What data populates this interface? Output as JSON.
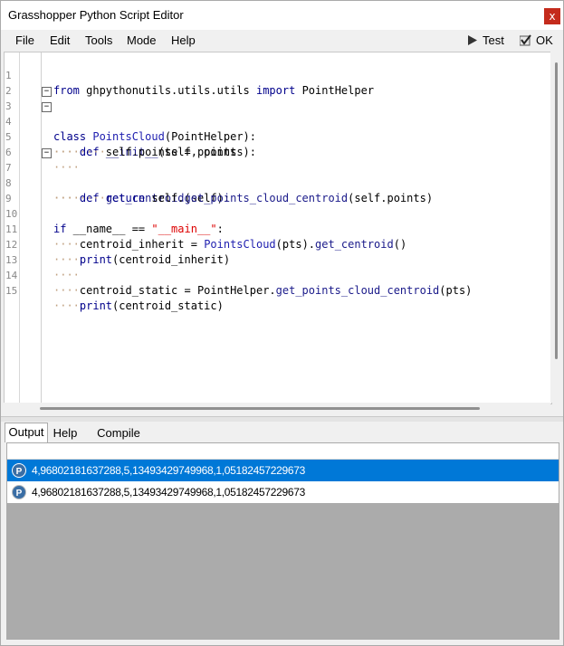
{
  "window": {
    "title": "Grasshopper Python Script Editor",
    "close": "x"
  },
  "menu": {
    "items": [
      "File",
      "Edit",
      "Tools",
      "Mode",
      "Help"
    ]
  },
  "toolbar": {
    "test_label": "Test",
    "ok_label": "OK"
  },
  "editor": {
    "lines": [
      {
        "n": "1"
      },
      {
        "n": "2"
      },
      {
        "n": "3"
      },
      {
        "n": "4"
      },
      {
        "n": "5"
      },
      {
        "n": "6"
      },
      {
        "n": "7"
      },
      {
        "n": "8"
      },
      {
        "n": "9"
      },
      {
        "n": "10"
      },
      {
        "n": "11"
      },
      {
        "n": "12"
      },
      {
        "n": "13"
      },
      {
        "n": "14"
      },
      {
        "n": "15"
      }
    ],
    "tokens": {
      "l1": [
        "from",
        " ghpythonutils.utils.utils ",
        "import",
        " PointHelper"
      ],
      "l3": [
        "class",
        " ",
        "PointsCloud",
        "(PointHelper):"
      ],
      "l4": [
        "····",
        "def",
        " ",
        "__init__",
        "(self, points):"
      ],
      "l5": [
        "········",
        "self.points = points"
      ],
      "l6": [
        "····"
      ],
      "l7": [
        "····",
        "def",
        " ",
        "get_centroid",
        "(self):"
      ],
      "l8": [
        "········",
        "return",
        " self.",
        "get_points_cloud_centroid",
        "(self.points)"
      ],
      "l10": [
        "if",
        " __name__ == ",
        "\"__main__\"",
        ":"
      ],
      "l11": [
        "····",
        "centroid_inherit = ",
        "PointsCloud",
        "(pts).",
        "get_centroid",
        "()"
      ],
      "l12": [
        "····",
        "print",
        "(centroid_inherit)"
      ],
      "l13": [
        "····"
      ],
      "l14": [
        "····",
        "centroid_static = PointHelper.",
        "get_points_cloud_centroid",
        "(pts)"
      ],
      "l15": [
        "····",
        "print",
        "(centroid_static)"
      ]
    }
  },
  "tabs": [
    "Output",
    "Help",
    "Compile"
  ],
  "output": {
    "rows": [
      "4,96802181637288,5,13493429749968,1,05182457229673",
      "4,96802181637288,5,13493429749968,1,05182457229673"
    ]
  },
  "colors": {
    "selection": "#0078d7",
    "keyword": "#00008b",
    "string": "#dd0000",
    "close": "#c42b1c"
  }
}
